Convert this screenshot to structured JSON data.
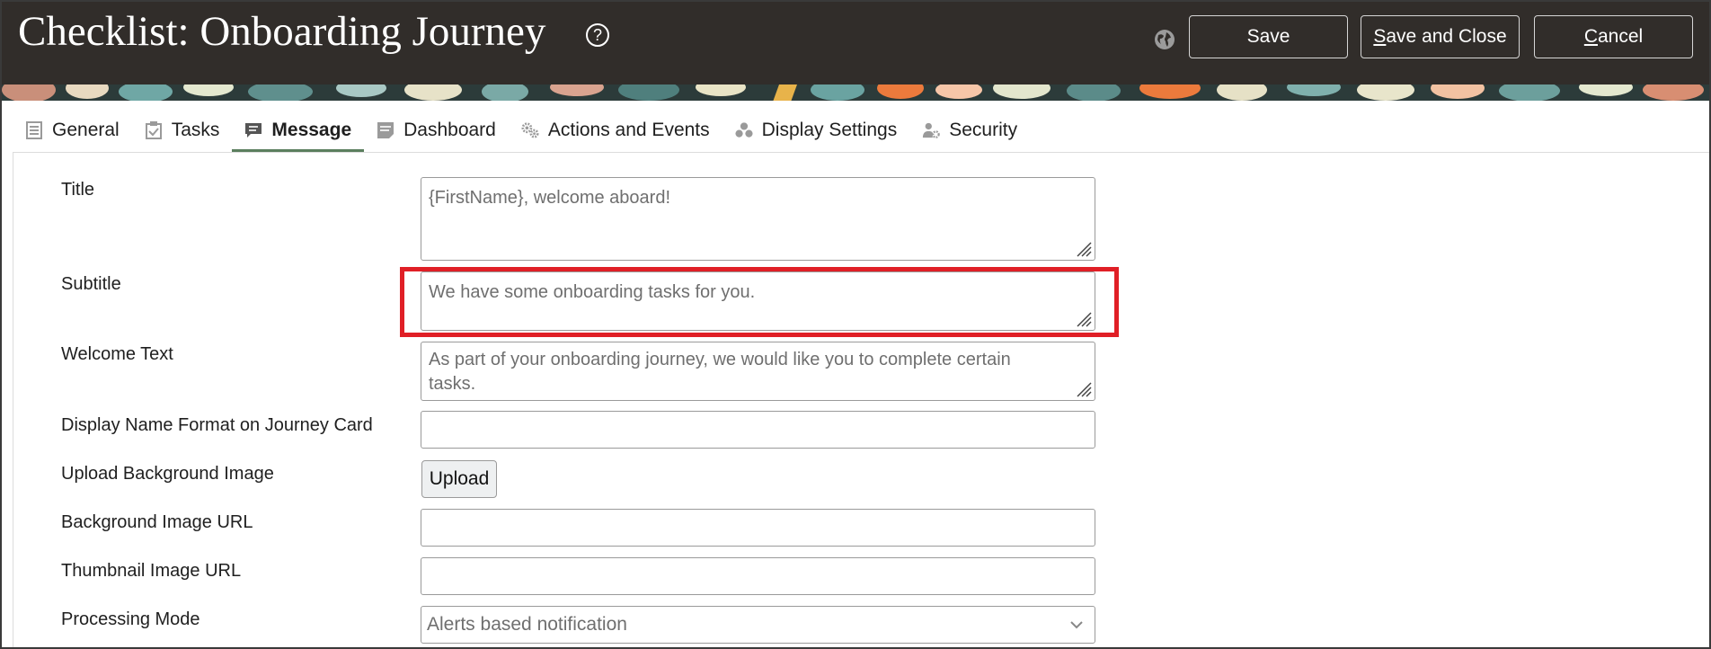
{
  "header": {
    "title": "Checklist: Onboarding Journey",
    "help_icon": "help-circle-icon",
    "globe_icon": "globe-icon",
    "buttons": {
      "save": "Save",
      "save_and_close_prefix": "S",
      "save_and_close_rest": "ave and Close",
      "cancel_prefix": "C",
      "cancel_rest": "ancel"
    },
    "bg_color": "#312d2a"
  },
  "tabs": [
    {
      "label": "General",
      "icon": "list-icon",
      "active": false
    },
    {
      "label": "Tasks",
      "icon": "clipboard-check-icon",
      "active": false
    },
    {
      "label": "Message",
      "icon": "chat-bubble-icon",
      "active": true
    },
    {
      "label": "Dashboard",
      "icon": "document-icon",
      "active": false
    },
    {
      "label": "Actions and Events",
      "icon": "gears-icon",
      "active": false
    },
    {
      "label": "Display Settings",
      "icon": "circles-icon",
      "active": false
    },
    {
      "label": "Security",
      "icon": "user-gear-icon",
      "active": false
    }
  ],
  "form": {
    "title": {
      "label": "Title",
      "value": "{FirstName}, welcome aboard!"
    },
    "subtitle": {
      "label": "Subtitle",
      "value": "We have some onboarding tasks for you."
    },
    "welcome_text": {
      "label": "Welcome Text",
      "value": "As part of your onboarding journey, we would like you to complete certain tasks."
    },
    "display_name_format": {
      "label": "Display Name Format on Journey Card",
      "value": ""
    },
    "upload_background": {
      "label": "Upload Background Image",
      "button": "Upload"
    },
    "background_url": {
      "label": "Background Image URL",
      "value": ""
    },
    "thumbnail_url": {
      "label": "Thumbnail Image URL",
      "value": ""
    },
    "processing_mode": {
      "label": "Processing Mode",
      "value": "Alerts based notification"
    }
  },
  "colors": {
    "accent_tab_underline": "#5b7f5e",
    "highlight_box": "#e01f26"
  }
}
